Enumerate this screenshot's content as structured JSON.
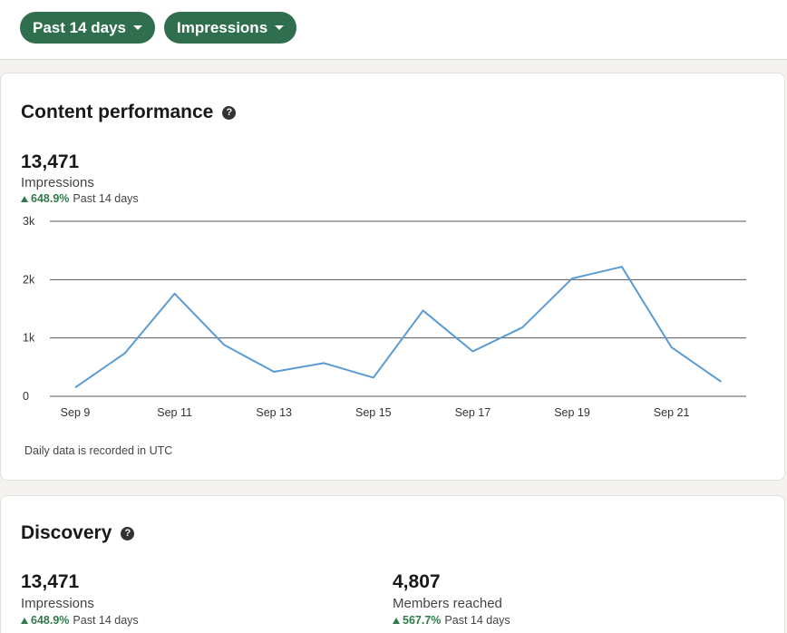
{
  "filters": {
    "period_label": "Past 14 days",
    "metric_label": "Impressions"
  },
  "content_performance": {
    "title": "Content performance",
    "help_icon": "question-circle-icon",
    "value": "13,471",
    "label": "Impressions",
    "change_pct": "648.9%",
    "change_period": "Past 14 days",
    "note": "Daily data is recorded in UTC"
  },
  "discovery": {
    "title": "Discovery",
    "help_icon": "question-circle-icon",
    "impressions": {
      "value": "13,471",
      "label": "Impressions",
      "change_pct": "648.9%",
      "change_period": "Past 14 days"
    },
    "members_reached": {
      "value": "4,807",
      "label": "Members reached",
      "change_pct": "567.7%",
      "change_period": "Past 14 days"
    }
  },
  "colors": {
    "accent_green": "#2f6e4e",
    "positive_green": "#2f7a4b",
    "line_blue": "#5b9bd5"
  },
  "chart_data": {
    "type": "line",
    "x": [
      "Sep 9",
      "Sep 10",
      "Sep 11",
      "Sep 12",
      "Sep 13",
      "Sep 14",
      "Sep 15",
      "Sep 16",
      "Sep 17",
      "Sep 18",
      "Sep 19",
      "Sep 20",
      "Sep 21",
      "Sep 22"
    ],
    "x_tick_labels": [
      "Sep 9",
      "Sep 11",
      "Sep 13",
      "Sep 15",
      "Sep 17",
      "Sep 19",
      "Sep 21"
    ],
    "y_tick_labels": [
      "0",
      "1k",
      "2k",
      "3k"
    ],
    "y_ticks": [
      0,
      1000,
      2000,
      3000
    ],
    "ylim": [
      0,
      3000
    ],
    "series": [
      {
        "values": [
          150,
          740,
          1760,
          880,
          420,
          570,
          320,
          1470,
          770,
          1180,
          2020,
          2220,
          840,
          250
        ]
      }
    ],
    "grid": "horizontal",
    "legend": "none"
  }
}
